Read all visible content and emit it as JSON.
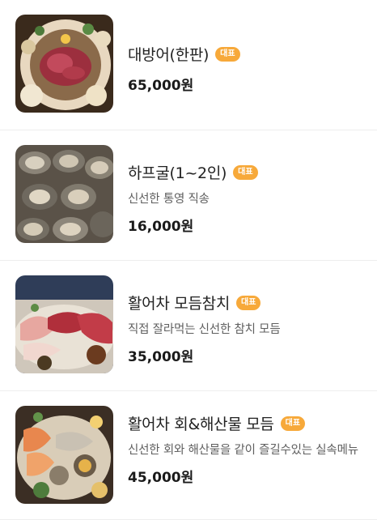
{
  "menu": {
    "items": [
      {
        "name": "대방어(한판)",
        "badge": "대표",
        "description": "",
        "price": "65,000원",
        "image_icon": "yellowtail-sashimi-platter-photo"
      },
      {
        "name": "하프굴(1~2인)",
        "badge": "대표",
        "description": "신선한 통영 직송",
        "price": "16,000원",
        "image_icon": "oyster-platter-photo"
      },
      {
        "name": "활어차 모듬참치",
        "badge": "대표",
        "description": "직접 잘라먹는 신선한 참치 모듬",
        "price": "35,000원",
        "image_icon": "tuna-platter-photo"
      },
      {
        "name": "활어차 회&해산물 모듬",
        "badge": "대표",
        "description": "신선한 회와 해산물을 같이 즐길수있는 실속메뉴",
        "price": "45,000원",
        "image_icon": "sashimi-seafood-platter-photo"
      }
    ]
  }
}
